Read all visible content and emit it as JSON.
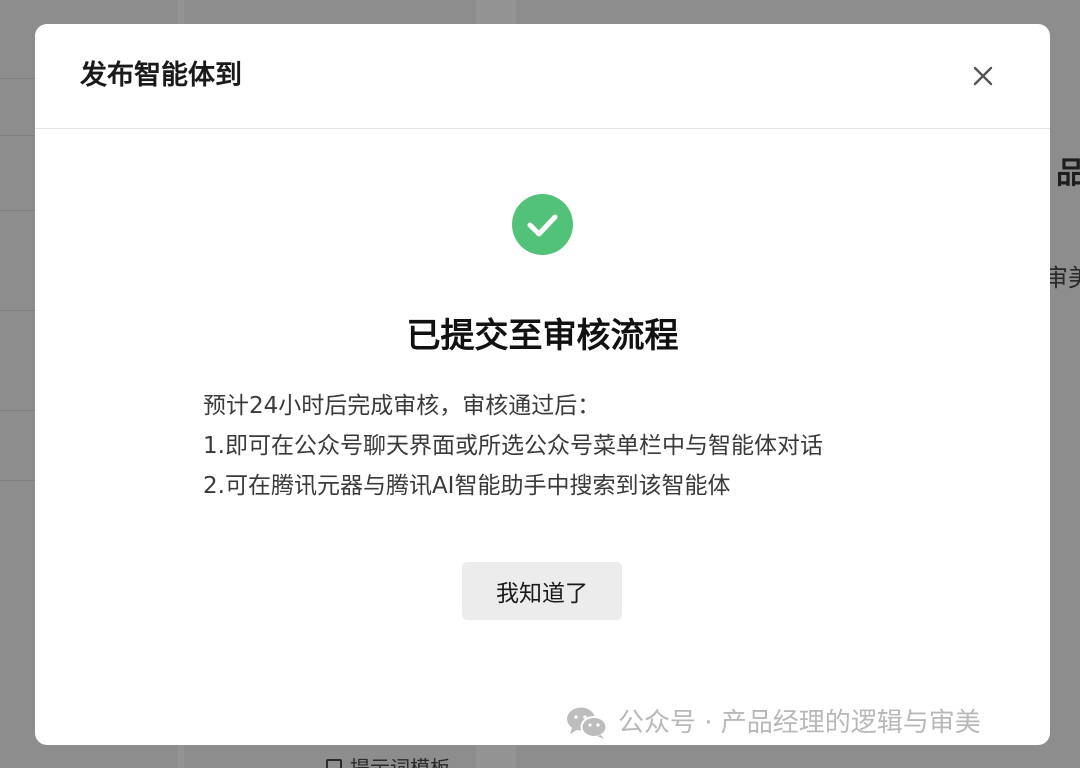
{
  "background": {
    "right_heading_fragment": "品",
    "right_text_fragment": "审美",
    "bottom_link_text": "提示词模板"
  },
  "modal": {
    "title": "发布智能体到",
    "close_icon": "close-icon",
    "status_icon": "check-circle-icon",
    "status_color": "#52c27a",
    "result_title": "已提交至审核流程",
    "description_lines": [
      "预计24小时后完成审核，审核通过后：",
      "1.即可在公众号聊天界面或所选公众号菜单栏中与智能体对话",
      "2.可在腾讯元器与腾讯AI智能助手中搜索到该智能体"
    ],
    "confirm_button": "我知道了"
  },
  "watermark": {
    "icon": "wechat-icon",
    "text": "公众号 · 产品经理的逻辑与审美"
  }
}
